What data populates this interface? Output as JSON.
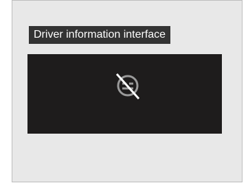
{
  "caption": {
    "label": "Driver information interface"
  },
  "display": {
    "icon": "no-cruise-control-icon"
  },
  "colors": {
    "panel_background": "#e8e8e8",
    "caption_background": "#333333",
    "screen_background": "#1e1c1c",
    "icon_color": "#9a9a9a"
  }
}
